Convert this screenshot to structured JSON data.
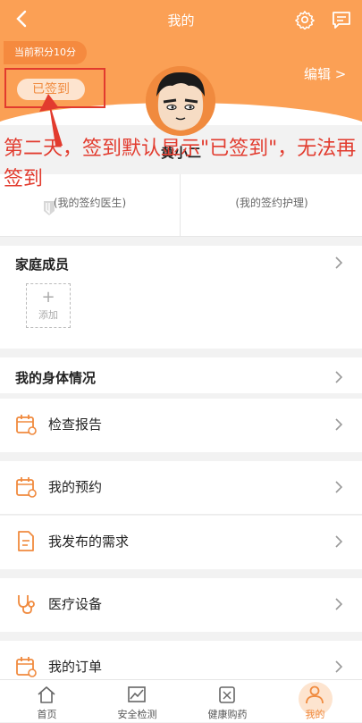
{
  "header": {
    "title": "我的",
    "points": "当前积分10分",
    "signed_label": "已签到",
    "edit_label": "编辑 >",
    "user_name": "黄小二"
  },
  "annotation": {
    "text": "第二天，签到默认显示\"已签到\"，无法再签到"
  },
  "contracts": {
    "doctor": "(我的签约医生)",
    "nurse": "(我的签约护理)"
  },
  "family": {
    "title": "家庭成员",
    "add_label": "添加"
  },
  "body_status": {
    "title": "我的身体情况"
  },
  "menu": [
    {
      "label": "检查报告",
      "icon": "calendar-icon"
    },
    {
      "label": "我的预约",
      "icon": "calendar-icon"
    },
    {
      "label": "我发布的需求",
      "icon": "document-icon"
    },
    {
      "label": "医疗设备",
      "icon": "stethoscope-icon"
    },
    {
      "label": "我的订单",
      "icon": "calendar-icon"
    }
  ],
  "tabs": [
    {
      "label": "首页",
      "icon": "home-icon"
    },
    {
      "label": "安全检测",
      "icon": "chart-icon"
    },
    {
      "label": "健康购药",
      "icon": "medicine-icon"
    },
    {
      "label": "我的",
      "icon": "user-icon",
      "active": true
    }
  ],
  "colors": {
    "brand": "#fba055",
    "accent": "#f08a3e",
    "annotation": "#e23b2e"
  }
}
